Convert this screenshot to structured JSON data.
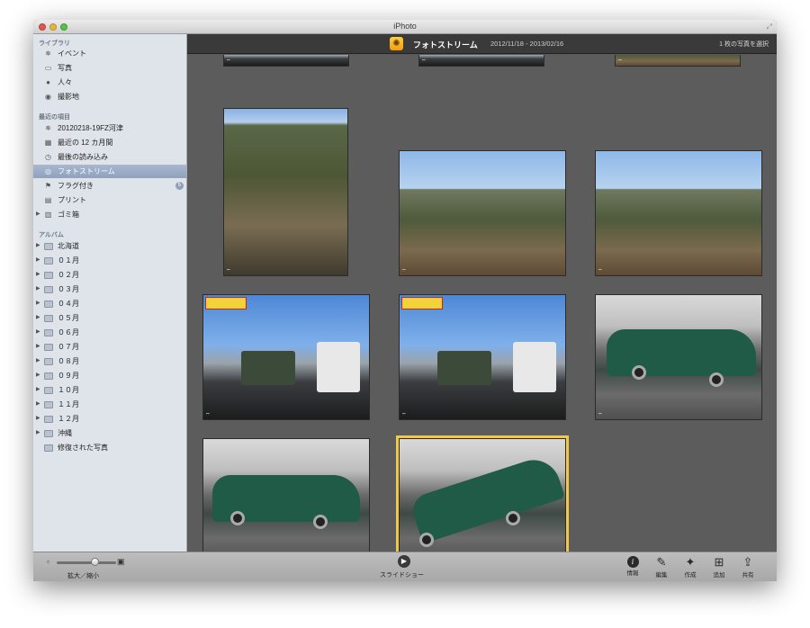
{
  "window": {
    "title": "iPhoto"
  },
  "sidebar": {
    "library_header": "ライブラリ",
    "library_items": [
      {
        "label": "イベント",
        "icon": "events-icon"
      },
      {
        "label": "写真",
        "icon": "photos-icon"
      },
      {
        "label": "人々",
        "icon": "faces-icon"
      },
      {
        "label": "撮影地",
        "icon": "places-icon"
      }
    ],
    "recent_header": "最近の項目",
    "recent_items": [
      {
        "label": "20120218-19FZ河津",
        "icon": "events-icon"
      },
      {
        "label": "最近の 12 カ月間",
        "icon": "calendar-icon"
      },
      {
        "label": "最後の読み込み",
        "icon": "last-import-icon"
      },
      {
        "label": "フォトストリーム",
        "icon": "photostream-icon",
        "selected": true
      },
      {
        "label": "フラグ付き",
        "icon": "flag-icon",
        "badge": "5"
      },
      {
        "label": "プリント",
        "icon": "print-icon"
      },
      {
        "label": "ゴミ箱",
        "icon": "trash-icon",
        "disclosure": true
      }
    ],
    "album_header": "アルバム",
    "albums": [
      "北海道",
      "０１月",
      "０２月",
      "０３月",
      "０４月",
      "０５月",
      "０６月",
      "０７月",
      "０８月",
      "０９月",
      "１０月",
      "１１月",
      "１２月",
      "沖縄"
    ],
    "smart_album": "修復された写真"
  },
  "header": {
    "title": "フォトストリーム",
    "dates": "2012/11/18 - 2013/02/16",
    "selection": "1 枚の写真を選択"
  },
  "toolbar": {
    "zoom_label": "拡大／縮小",
    "zoom_level": 0.65,
    "slideshow_label": "スライドショー",
    "info_label": "情報",
    "edit_label": "編集",
    "create_label": "作成",
    "add_label": "追加",
    "share_label": "共有"
  },
  "stream_mark": "⌔"
}
